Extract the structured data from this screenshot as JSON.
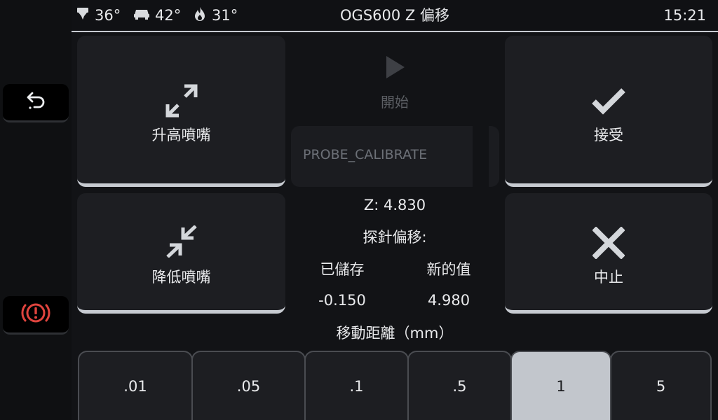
{
  "header": {
    "extruder_temp": "36°",
    "bed_temp": "42°",
    "heater_temp": "31°",
    "title": "OGS600 Z 偏移",
    "time": "15:21"
  },
  "sidebar": {
    "back_icon": "back-icon",
    "emergency_icon": "emergency-stop-icon"
  },
  "buttons": {
    "raise_nozzle": "升高噴嘴",
    "lower_nozzle": "降低噴嘴",
    "start": "開始",
    "accept": "接受",
    "abort": "中止"
  },
  "command": {
    "text": "PROBE_CALIBRATE"
  },
  "status": {
    "z_value": "Z: 4.830",
    "probe_offset_label": "探針偏移:",
    "saved_label": "已儲存",
    "new_label": "新的值",
    "saved_value": "-0.150",
    "new_value": "4.980"
  },
  "distance": {
    "label": "移動距離（mm）",
    "options": [
      ".01",
      ".05",
      ".1",
      ".5",
      "1",
      "5"
    ],
    "selected": "1"
  },
  "colors": {
    "background": "#121316",
    "panel": "#1d1e22",
    "accent": "#c7cbd1",
    "emergency": "#e0443e",
    "selected": "#c2c6cc"
  }
}
